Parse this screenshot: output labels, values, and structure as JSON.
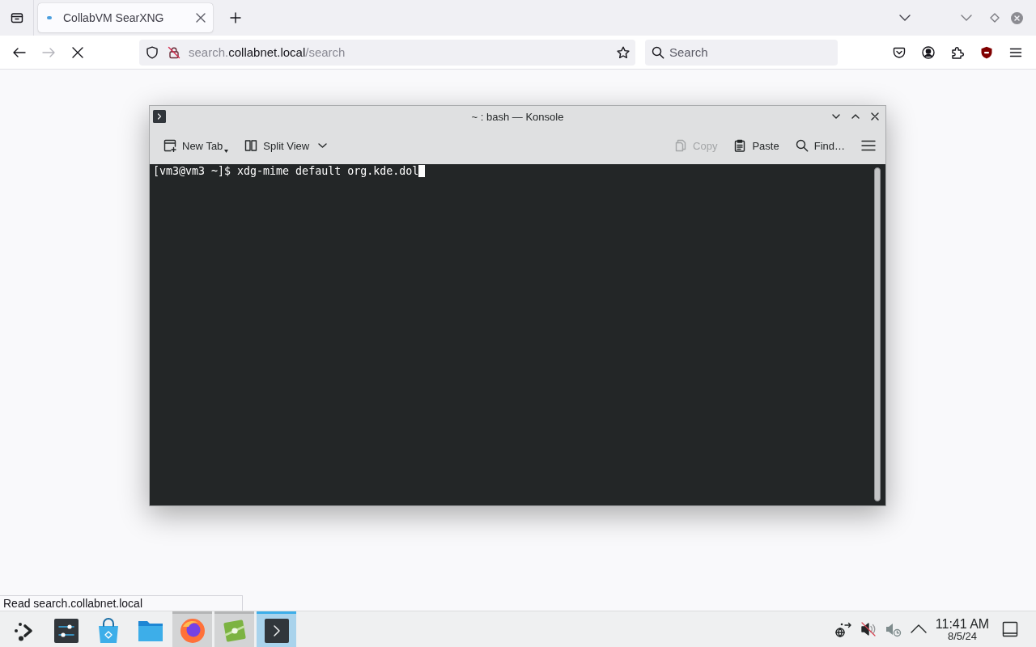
{
  "browser": {
    "tabs": [
      {
        "title": "CollabVM SearXNG",
        "selected": true
      }
    ],
    "nav_buttons": [
      {
        "kind": "back",
        "disabled": false
      },
      {
        "kind": "forward",
        "disabled": true
      },
      {
        "kind": "stop",
        "disabled": false
      }
    ],
    "address": {
      "subdomain": "search.",
      "domain": "collabnet.local",
      "path": "/search"
    },
    "search": {
      "placeholder": "Search"
    },
    "status": "Read search.collabnet.local"
  },
  "konsole": {
    "title": "~ : bash — Konsole",
    "toolbar": [
      {
        "kind": "new-tab",
        "label": "New Tab",
        "disabled": false
      },
      {
        "kind": "split-view",
        "label": "Split View",
        "disabled": false
      },
      {
        "kind": "copy",
        "label": "Copy",
        "disabled": true
      },
      {
        "kind": "paste",
        "label": "Paste",
        "disabled": false
      },
      {
        "kind": "find",
        "label": "Find…",
        "disabled": false
      },
      {
        "kind": "menu",
        "disabled": false
      }
    ],
    "terminal": {
      "lines": [
        "[vm3@vm3 ~]$ xdg-mime default org.kde.dol"
      ],
      "cursor": true
    }
  },
  "taskbar": {
    "items": [
      {
        "kind": "launcher",
        "running": false,
        "selected": false
      },
      {
        "kind": "settings",
        "running": false,
        "selected": false
      },
      {
        "kind": "store",
        "running": false,
        "selected": false
      },
      {
        "kind": "files",
        "running": false,
        "selected": false
      },
      {
        "kind": "browser",
        "running": true,
        "selected": false
      },
      {
        "kind": "app",
        "running": true,
        "selected": false
      },
      {
        "kind": "terminal",
        "running": true,
        "selected": true
      }
    ],
    "clock": {
      "time": "11:41 AM",
      "date": "8/5/24"
    }
  }
}
